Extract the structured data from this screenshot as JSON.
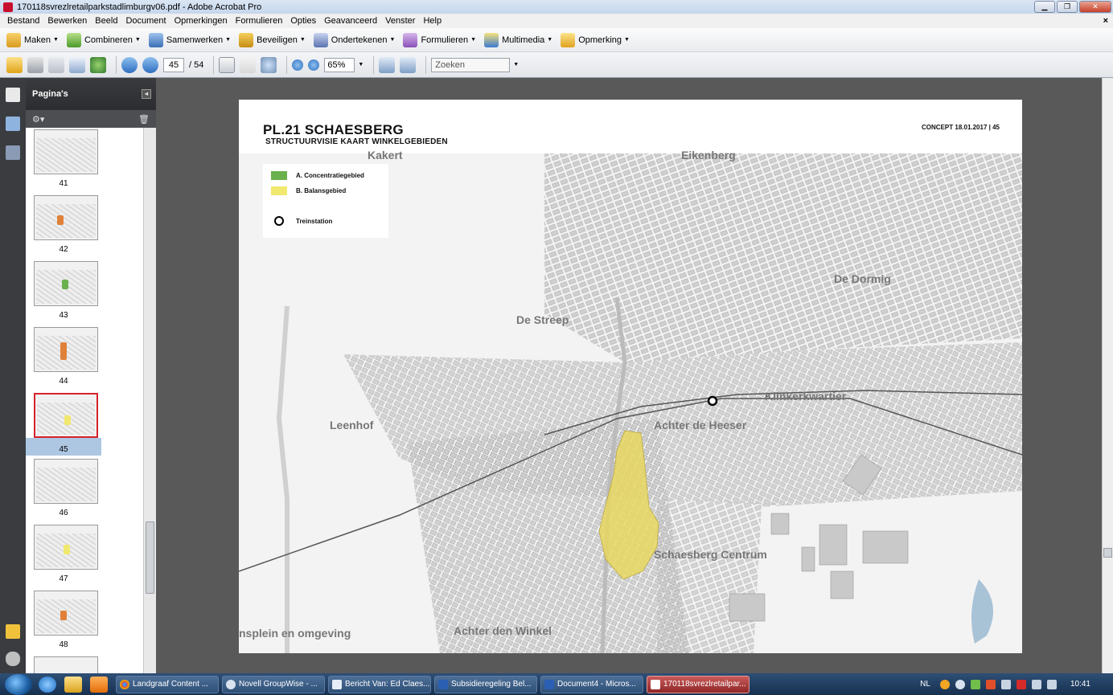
{
  "window": {
    "title": "170118svrezlretailparkstadlimburgv06.pdf - Adobe Acrobat Pro"
  },
  "menu": [
    "Bestand",
    "Bewerken",
    "Beeld",
    "Document",
    "Opmerkingen",
    "Formulieren",
    "Opties",
    "Geavanceerd",
    "Venster",
    "Help"
  ],
  "menu_close": "×",
  "task_buttons": [
    "Maken",
    "Combineren",
    "Samenwerken",
    "Beveiligen",
    "Ondertekenen",
    "Formulieren",
    "Multimedia",
    "Opmerking"
  ],
  "nav": {
    "page": "45",
    "total": "/ 54",
    "zoom": "65%",
    "search_placeholder": "Zoeken"
  },
  "panel": {
    "title": "Pagina's"
  },
  "thumbnails": [
    "41",
    "42",
    "43",
    "44",
    "45",
    "46",
    "47",
    "48"
  ],
  "selected_page": "45",
  "page": {
    "title": "PL.21 SCHAESBERG",
    "subtitle": "STRUCTUURVISIE KAART WINKELGEBIEDEN",
    "concept": "CONCEPT 18.01.2017 | 45",
    "legend": [
      {
        "label": "A. Concentratiegebied",
        "color": "#6ab04c"
      },
      {
        "label": "B. Balansgebied",
        "color": "#f1e86f"
      },
      {
        "label": "Treinstation"
      }
    ],
    "areas": [
      "Kakert",
      "Eikenberg",
      "De Dormig",
      "De Streep",
      "Klinkerkwartier",
      "Leenhof",
      "Achter de Heeser",
      "Schaesberg Centrum",
      "Achter den Winkel",
      "nsplein en omgeving"
    ]
  },
  "taskbar": {
    "tasks": [
      "Landgraaf Content ...",
      "Novell GroupWise - ...",
      "Bericht Van: Ed Claes...",
      "Subsidieregeling Bel...",
      "Document4 - Micros...",
      "170118svrezlretailpar..."
    ],
    "language": "NL",
    "time": "10:41"
  }
}
